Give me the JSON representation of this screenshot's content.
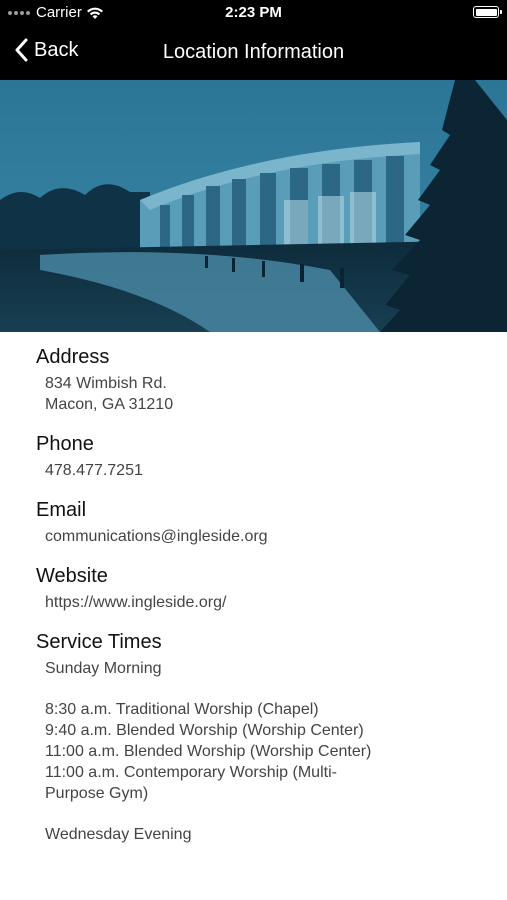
{
  "status_bar": {
    "carrier": "Carrier",
    "time": "2:23 PM"
  },
  "nav": {
    "back_label": "Back",
    "title": "Location Information"
  },
  "hero": {
    "description": "building-photo",
    "tint": "#1e6a8a"
  },
  "sections": {
    "address": {
      "heading": "Address",
      "line1": "834 Wimbish Rd.",
      "line2": "Macon, GA 31210"
    },
    "phone": {
      "heading": "Phone",
      "value": "478.477.7251"
    },
    "email": {
      "heading": "Email",
      "value": "communications@ingleside.org"
    },
    "website": {
      "heading": "Website",
      "value": "https://www.ingleside.org/"
    },
    "service_times": {
      "heading": "Service Times",
      "group1": "Sunday Morning",
      "line1": "8:30 a.m. Traditional Worship (Chapel)",
      "line2": "9:40 a.m. Blended Worship (Worship Center)",
      "line3": "11:00 a.m. Blended Worship (Worship Center)",
      "line4": "11:00 a.m. Contemporary Worship (Multi-",
      "line5": "Purpose Gym)",
      "group2": "Wednesday Evening"
    }
  },
  "colors": {
    "bar": "#000000",
    "heading": "#111111",
    "body_text": "#444444"
  }
}
